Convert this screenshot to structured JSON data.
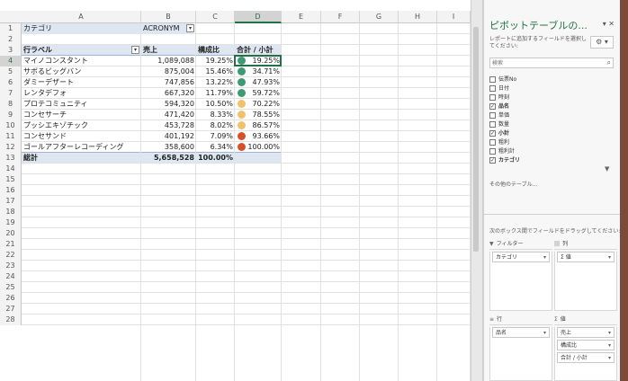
{
  "sheet": {
    "columns": [
      "A",
      "B",
      "C",
      "D",
      "E",
      "F",
      "G",
      "H",
      "I"
    ],
    "row_numbers": [
      "1",
      "2",
      "3",
      "4",
      "5",
      "6",
      "7",
      "8",
      "9",
      "10",
      "11",
      "12",
      "13",
      "14",
      "15",
      "16",
      "17",
      "18",
      "19",
      "20",
      "21",
      "22",
      "23",
      "24",
      "25",
      "26",
      "27",
      "28"
    ],
    "filter": {
      "label": "カテゴリ",
      "value": "ACRONYM"
    },
    "headers": {
      "row_label": "行ラベル",
      "sales": "売上",
      "ratio": "構成比",
      "cumulative": "合計 / 小計"
    },
    "rows": [
      {
        "label": "マイノコンスタント",
        "sales": "1,089,088",
        "ratio": "19.25%",
        "cumulative": "19.25%",
        "dot": "green"
      },
      {
        "label": "サボるビッグバン",
        "sales": "875,004",
        "ratio": "15.46%",
        "cumulative": "34.71%",
        "dot": "green"
      },
      {
        "label": "ダミーデザート",
        "sales": "747,856",
        "ratio": "13.22%",
        "cumulative": "47.93%",
        "dot": "green"
      },
      {
        "label": "レンタデフォ",
        "sales": "667,320",
        "ratio": "11.79%",
        "cumulative": "59.72%",
        "dot": "green"
      },
      {
        "label": "プロテコミュニティ",
        "sales": "594,320",
        "ratio": "10.50%",
        "cumulative": "70.22%",
        "dot": "yellow"
      },
      {
        "label": "コンセサーチ",
        "sales": "471,420",
        "ratio": "8.33%",
        "cumulative": "78.55%",
        "dot": "yellow"
      },
      {
        "label": "プッシエキゾチック",
        "sales": "453,728",
        "ratio": "8.02%",
        "cumulative": "86.57%",
        "dot": "yellow"
      },
      {
        "label": "コンセサンド",
        "sales": "401,192",
        "ratio": "7.09%",
        "cumulative": "93.66%",
        "dot": "red"
      },
      {
        "label": "ゴールアフターレコーディング",
        "sales": "358,600",
        "ratio": "6.34%",
        "cumulative": "100.00%",
        "dot": "red"
      }
    ],
    "total": {
      "label": "総計",
      "sales": "5,658,528",
      "ratio": "100.00%"
    },
    "colors": {
      "green": "#3d9a73",
      "yellow": "#f0c168",
      "red": "#d84f2a",
      "accent": "#217346",
      "band": "#dde6f1"
    }
  },
  "pane": {
    "title": "ピボットテーブルの...",
    "icons": "▾ ✕",
    "description": "レポートに追加するフィールドを選択してください:",
    "gear": "⚙ ▾",
    "search_placeholder": "検索",
    "fields": [
      {
        "name": "伝票No",
        "checked": false
      },
      {
        "name": "日付",
        "checked": false
      },
      {
        "name": "時刻",
        "checked": false
      },
      {
        "name": "品名",
        "checked": true
      },
      {
        "name": "単価",
        "checked": false
      },
      {
        "name": "数量",
        "checked": false
      },
      {
        "name": "小計",
        "checked": true
      },
      {
        "name": "粗利",
        "checked": false
      },
      {
        "name": "粗利計",
        "checked": false
      },
      {
        "name": "カテゴリ",
        "checked": true
      }
    ],
    "more_tables": "その他のテーブル...",
    "drag_hint": "次のボックス間でフィールドをドラッグしてください:",
    "areas": {
      "filter": {
        "title": "フィルター",
        "icon": "▼",
        "items": [
          "カテゴリ"
        ]
      },
      "columns": {
        "title": "列",
        "icon": "|||",
        "items": [
          "Σ 値"
        ]
      },
      "rows": {
        "title": "行",
        "icon": "≡",
        "items": [
          "品名"
        ]
      },
      "values": {
        "title": "値",
        "icon": "Σ",
        "items": [
          "売上",
          "構成比",
          "合計 / 小計"
        ]
      }
    }
  }
}
